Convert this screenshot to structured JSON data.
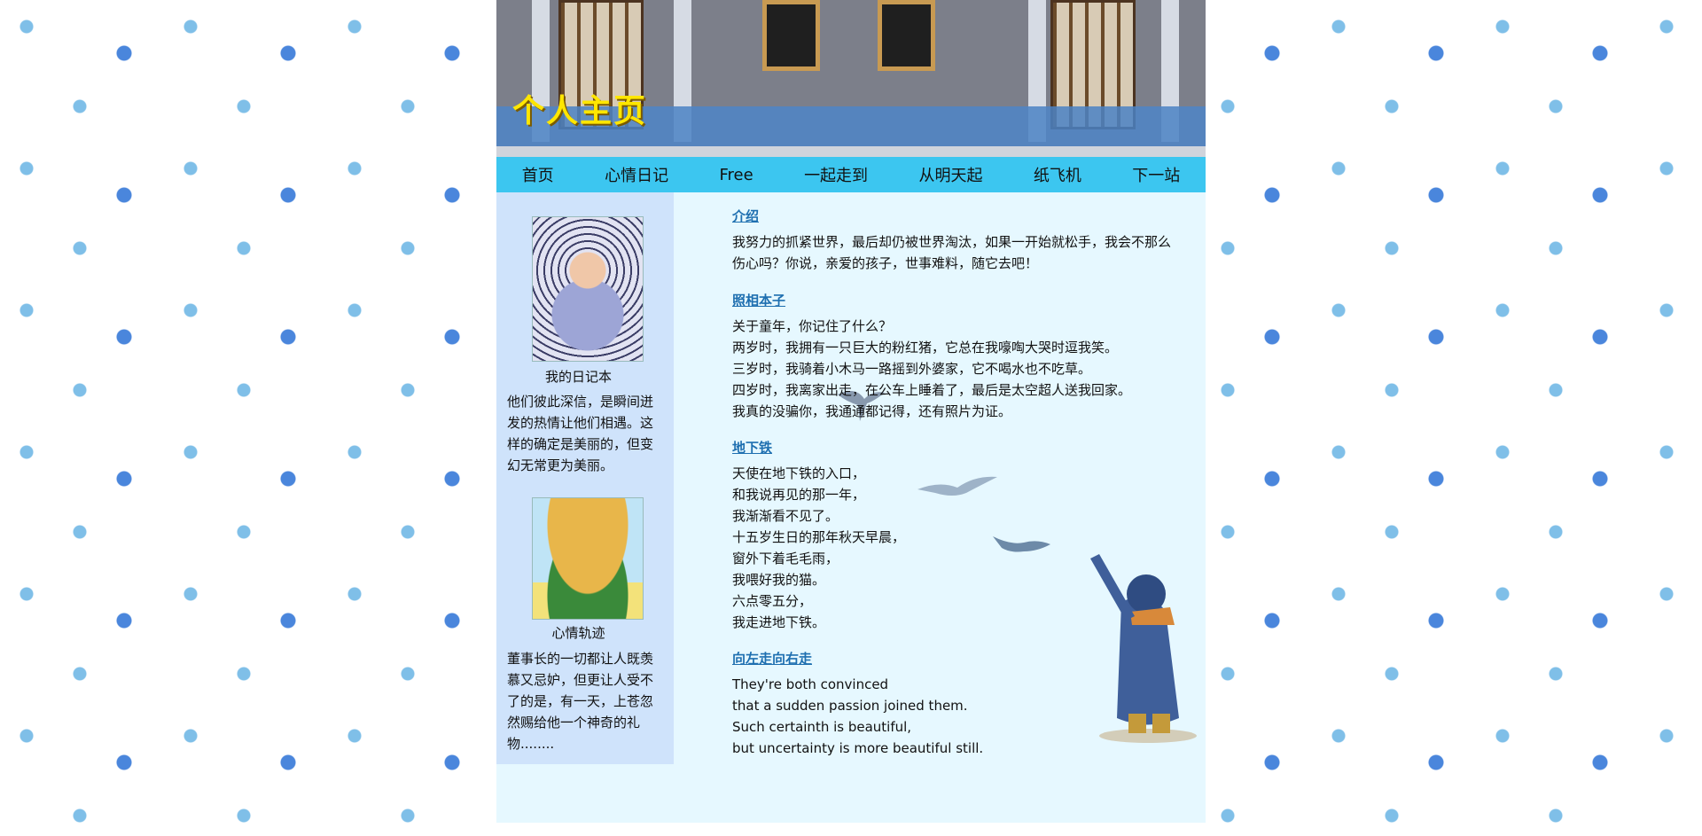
{
  "banner": {
    "title": "个人主页"
  },
  "nav": {
    "items": [
      "首页",
      "心情日记",
      "Free",
      "一起走到",
      "从明天起",
      "纸飞机",
      "下一站"
    ]
  },
  "sidebar": {
    "card1": {
      "caption": "我的日记本",
      "text": "他们彼此深信，是瞬间迸发的热情让他们相遇。这样的确定是美丽的，但变幻无常更为美丽。"
    },
    "card2": {
      "caption": "心情轨迹",
      "text": "董事长的一切都让人既羡慕又忌妒，但更让人受不了的是，有一天，上苍忽然赐给他一个神奇的礼物........"
    }
  },
  "content": {
    "sections": [
      {
        "title": "介绍",
        "lines": [
          "我努力的抓紧世界，最后却仍被世界淘汰，如果一开始就松手，我会不那么",
          "伤心吗？你说，亲爱的孩子，世事难料，随它去吧！"
        ]
      },
      {
        "title": "照相本子",
        "lines": [
          "关于童年，你记住了什么？",
          "两岁时，我拥有一只巨大的粉红猪，它总在我嚎啕大哭时逗我笑。",
          "三岁时，我骑着小木马一路摇到外婆家，它不喝水也不吃草。",
          "四岁时，我离家出走，在公车上睡着了，最后是太空超人送我回家。",
          "我真的没骗你，我通通都记得，还有照片为证。"
        ]
      },
      {
        "title": "地下铁",
        "lines": [
          "天使在地下铁的入口，",
          "和我说再见的那一年，",
          "我渐渐看不见了。",
          "十五岁生日的那年秋天早晨，",
          "窗外下着毛毛雨，",
          "我喂好我的猫。",
          "六点零五分，",
          "我走进地下铁。"
        ]
      },
      {
        "title": "向左走向右走",
        "lines": [
          "They're both convinced",
          "that a sudden passion joined them.",
          "Such certainth is beautiful,",
          "but uncertainty is more beautiful still."
        ]
      }
    ]
  }
}
